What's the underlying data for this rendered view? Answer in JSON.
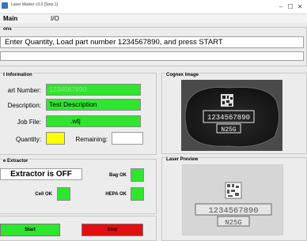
{
  "window": {
    "title": "Laser Marker v3.0 [Step 1]",
    "minimize_glyph": "–",
    "maximize_glyph": "☐",
    "close_glyph": "✕"
  },
  "menu": {
    "items": [
      "Main",
      "I/O"
    ]
  },
  "instructions": {
    "title": "ons",
    "text": "Enter Quantity, Load part number 1234567890, and press START",
    "secondary_text": ""
  },
  "part_information": {
    "title": "t Information",
    "part_number_label": "art Number:",
    "part_number_value": "1234567890",
    "description_label": "Description:",
    "description_value": "Test Description",
    "job_file_label": "Job File:",
    "job_file_value": ".wtj",
    "quantity_label": "Quantity:",
    "quantity_value": "",
    "remaining_label": "Remaining:",
    "remaining_value": ""
  },
  "extractor": {
    "title": "e Extractor",
    "status_text": "Extractor is OFF",
    "bag_ok_label": "Bag OK",
    "cell_ok_label": "Cell OK",
    "hepa_ok_label": "HEPA OK"
  },
  "cognex": {
    "title": "Cognex Image",
    "code_number": "1234567890",
    "code_suffix": "N25G"
  },
  "laser_preview": {
    "title": "Laser Preview",
    "code_number": "1234567890",
    "code_suffix": "N25G"
  },
  "buttons": {
    "start_label": "Start",
    "stop_label": "Stop"
  },
  "colors": {
    "status_ok": "#2ee62e",
    "quantity_highlight": "#ffff00",
    "start_button": "#2ee62e",
    "stop_button": "#e01010"
  }
}
